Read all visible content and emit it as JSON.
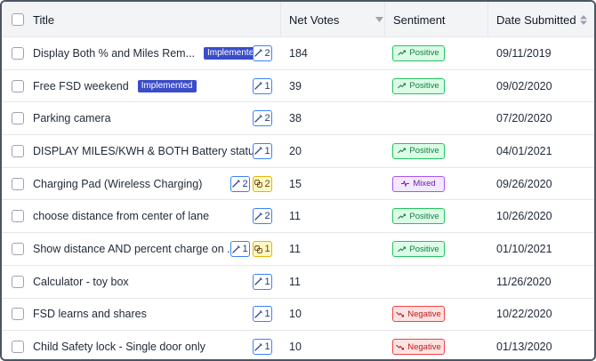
{
  "header": {
    "title": "Title",
    "net_votes": "Net Votes",
    "sentiment": "Sentiment",
    "date_submitted": "Date Submitted"
  },
  "rows": [
    {
      "title": "Display Both % and Miles Rem...",
      "badge": "Implemented",
      "chips": [
        {
          "kind": "wand",
          "count": "2"
        }
      ],
      "votes": "184",
      "sentiment": "Positive",
      "date": "09/11/2019"
    },
    {
      "title": "Free FSD weekend",
      "badge": "Implemented",
      "chips": [
        {
          "kind": "wand",
          "count": "1"
        }
      ],
      "votes": "39",
      "sentiment": "Positive",
      "date": "09/02/2020"
    },
    {
      "title": "Parking camera",
      "badge": "",
      "chips": [
        {
          "kind": "wand",
          "count": "2"
        }
      ],
      "votes": "38",
      "sentiment": "",
      "date": "07/20/2020"
    },
    {
      "title": "DISPLAY MILES/KWH & BOTH Battery status ...",
      "badge": "",
      "chips": [
        {
          "kind": "wand",
          "count": "1"
        }
      ],
      "votes": "20",
      "sentiment": "Positive",
      "date": "04/01/2021"
    },
    {
      "title": "Charging Pad (Wireless Charging)",
      "badge": "",
      "chips": [
        {
          "kind": "wand",
          "count": "2"
        },
        {
          "kind": "link",
          "count": "2"
        }
      ],
      "votes": "15",
      "sentiment": "Mixed",
      "date": "09/26/2020"
    },
    {
      "title": "choose distance from center of lane",
      "badge": "",
      "chips": [
        {
          "kind": "wand",
          "count": "2"
        }
      ],
      "votes": "11",
      "sentiment": "Positive",
      "date": "10/26/2020"
    },
    {
      "title": "Show distance AND percent charge on ...",
      "badge": "",
      "chips": [
        {
          "kind": "wand",
          "count": "1"
        },
        {
          "kind": "link",
          "count": "1"
        }
      ],
      "votes": "11",
      "sentiment": "Positive",
      "date": "01/10/2021"
    },
    {
      "title": "Calculator - toy box",
      "badge": "",
      "chips": [
        {
          "kind": "wand",
          "count": "1"
        }
      ],
      "votes": "11",
      "sentiment": "",
      "date": "11/26/2020"
    },
    {
      "title": "FSD learns and shares",
      "badge": "",
      "chips": [
        {
          "kind": "wand",
          "count": "1"
        }
      ],
      "votes": "10",
      "sentiment": "Negative",
      "date": "10/22/2020"
    },
    {
      "title": "Child Safety lock - Single door only",
      "badge": "",
      "chips": [
        {
          "kind": "wand",
          "count": "1"
        }
      ],
      "votes": "10",
      "sentiment": "Negative",
      "date": "01/13/2020"
    }
  ],
  "colors": {
    "implemented_badge": "#3b4cc9",
    "positive": "#22c55e",
    "mixed": "#a855f7",
    "negative": "#ef4444",
    "chip_blue": "#3b82f6",
    "chip_yellow": "#eab308"
  },
  "icons": {
    "sort_votes": "sort-desc-icon",
    "sort_date": "sort-both-icon",
    "wand_chip": "magic-wand-icon",
    "link_chip": "linked-items-icon",
    "positive": "trend-up-icon",
    "mixed": "pulse-icon",
    "negative": "trend-down-icon"
  }
}
